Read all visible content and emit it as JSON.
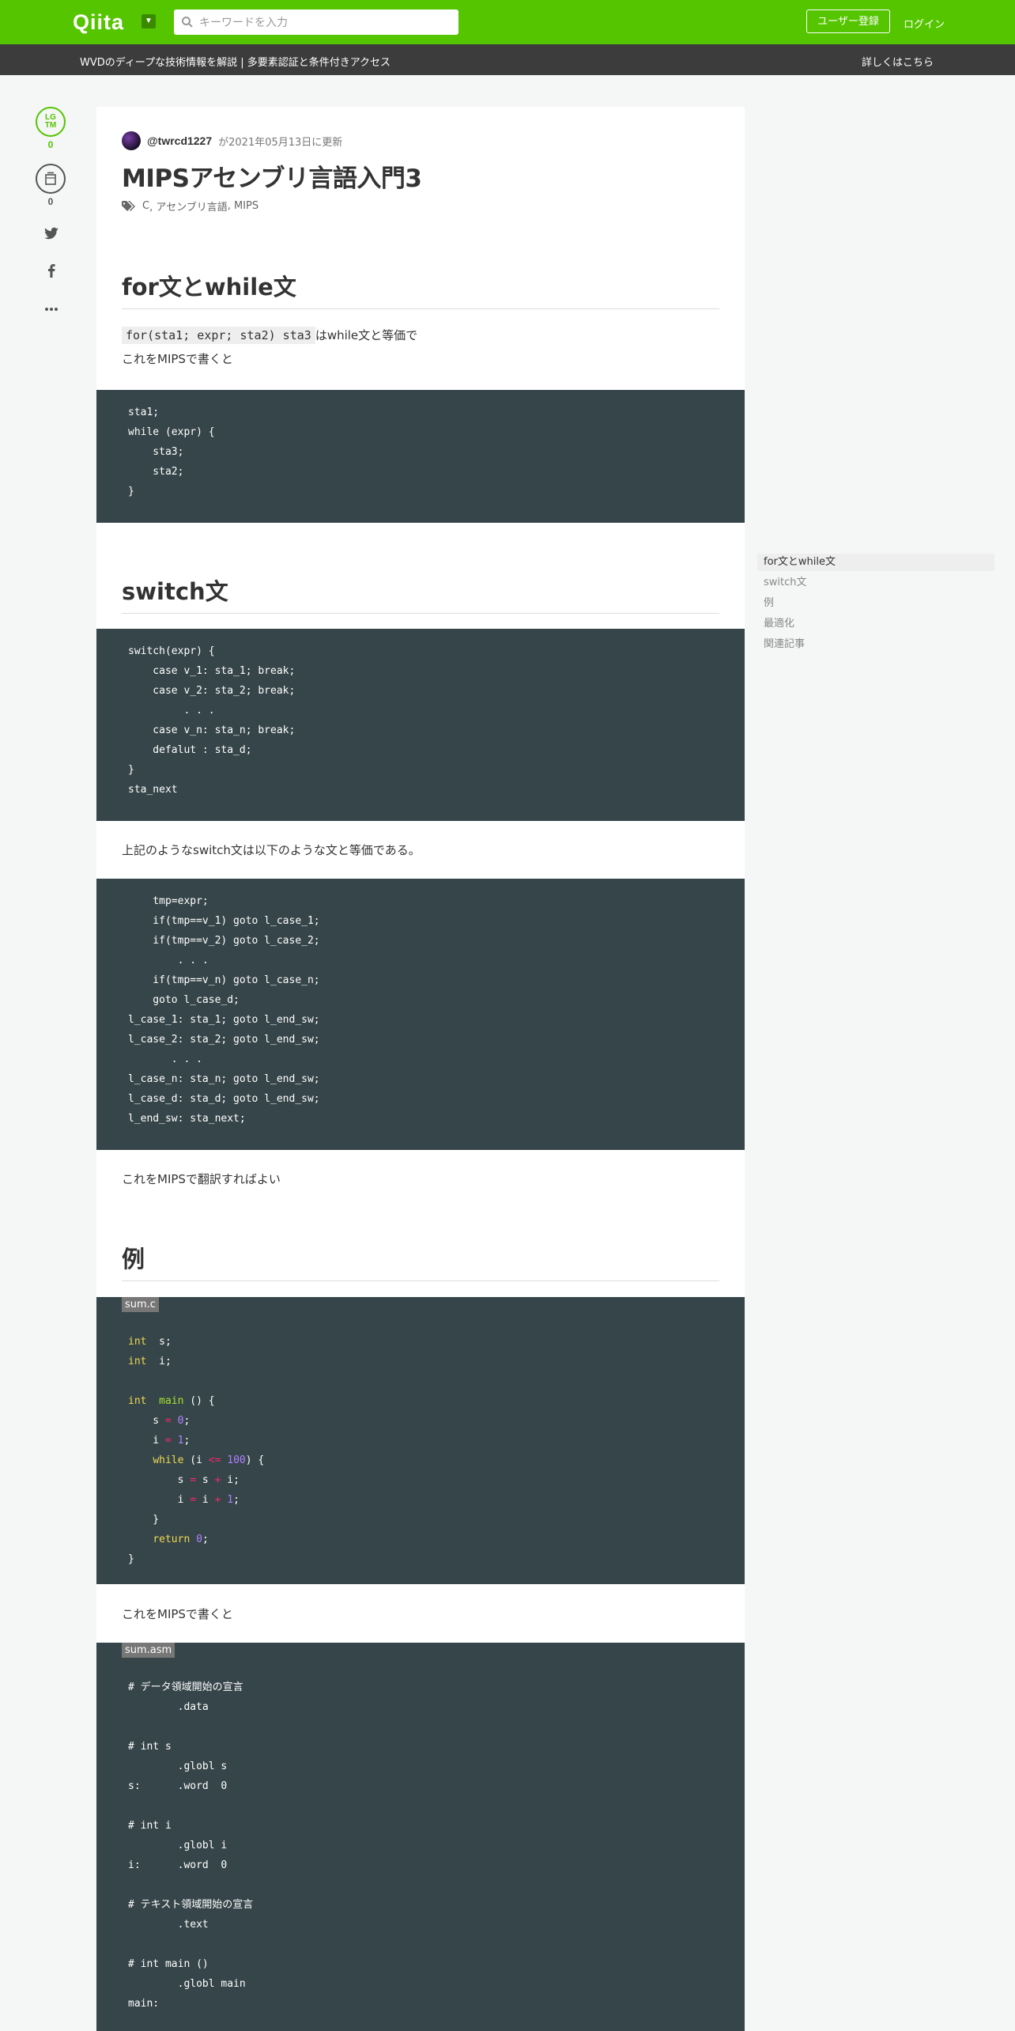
{
  "header": {
    "logo": "Qiita",
    "search_placeholder": "キーワードを入力",
    "signup_label": "ユーザー登録",
    "login_label": "ログイン"
  },
  "announcement": {
    "text": "WVDのディープな技術情報を解説 | 多要素認証と条件付きアクセス",
    "link": "詳しくはこちら"
  },
  "actions": {
    "lgtm_line1": "LG",
    "lgtm_line2": "TM",
    "lgtm_count": "0",
    "stock_count": "0"
  },
  "article": {
    "author": "@twrcd1227",
    "updated": "が2021年05月13日に更新",
    "title": "MIPSアセンブリ言語入門3",
    "tags": [
      "C",
      "アセンブリ言語",
      "MIPS"
    ],
    "sections": {
      "for_heading": "for文とwhile文",
      "for_inline_code": "for(sta1; expr; sta2) sta3",
      "for_text1": "はwhile文と等価で",
      "for_text2": "これをMIPSで書くと",
      "for_code": "sta1;\nwhile (expr) {\n    sta3;\n    sta2;\n}",
      "switch_heading": "switch文",
      "switch_code": "switch(expr) {\n    case v_1: sta_1; break;\n    case v_2: sta_2; break;\n         . . .\n    case v_n: sta_n; break;\n    defalut : sta_d;\n}\nsta_next",
      "switch_text": "上記のようなswitch文は以下のような文と等価である。",
      "goto_code": "    tmp=expr;\n    if(tmp==v_1) goto l_case_1;\n    if(tmp==v_2) goto l_case_2;\n        . . .\n    if(tmp==v_n) goto l_case_n;\n    goto l_case_d;\nl_case_1: sta_1; goto l_end_sw;\nl_case_2: sta_2; goto l_end_sw;\n       . . .\nl_case_n: sta_n; goto l_end_sw;\nl_case_d: sta_d; goto l_end_sw;\nl_end_sw: sta_next;",
      "translate_text": "これをMIPSで翻訳すればよい",
      "example_heading": "例",
      "sum_c_filename": "sum.c",
      "sum_c_lines": [
        [
          [
            "kw",
            "int"
          ],
          [
            "",
            "  s;"
          ]
        ],
        [
          [
            "kw",
            "int"
          ],
          [
            "",
            "  i;"
          ]
        ],
        [
          [
            "",
            ""
          ]
        ],
        [
          [
            "kw",
            "int"
          ],
          [
            "",
            "  "
          ],
          [
            "fn",
            "main"
          ],
          [
            "",
            " () {"
          ]
        ],
        [
          [
            "",
            "    s "
          ],
          [
            "op",
            "="
          ],
          [
            "",
            " "
          ],
          [
            "num",
            "0"
          ],
          [
            "",
            ";"
          ]
        ],
        [
          [
            "",
            "    i "
          ],
          [
            "op",
            "="
          ],
          [
            "",
            " "
          ],
          [
            "num",
            "1"
          ],
          [
            "",
            ";"
          ]
        ],
        [
          [
            "",
            "    "
          ],
          [
            "kw",
            "while"
          ],
          [
            "",
            " (i "
          ],
          [
            "op",
            "<="
          ],
          [
            "",
            " "
          ],
          [
            "num",
            "100"
          ],
          [
            "",
            ") {"
          ]
        ],
        [
          [
            "",
            "        s "
          ],
          [
            "op",
            "="
          ],
          [
            "",
            " s "
          ],
          [
            "op",
            "+"
          ],
          [
            "",
            " i;"
          ]
        ],
        [
          [
            "",
            "        i "
          ],
          [
            "op",
            "="
          ],
          [
            "",
            " i "
          ],
          [
            "op",
            "+"
          ],
          [
            "",
            " "
          ],
          [
            "num",
            "1"
          ],
          [
            "",
            ";"
          ]
        ],
        [
          [
            "",
            "    }"
          ]
        ],
        [
          [
            "",
            "    "
          ],
          [
            "kw",
            "return"
          ],
          [
            "",
            " "
          ],
          [
            "num",
            "0"
          ],
          [
            "",
            ";"
          ]
        ],
        [
          [
            "",
            "}"
          ]
        ]
      ],
      "mips_text": "これをMIPSで書くと",
      "sum_asm_filename": "sum.asm",
      "sum_asm_code": "# データ領域開始の宣言\n        .data\n\n# int s\n        .globl s\ns:      .word  0\n\n# int i\n        .globl i\ni:      .word  0\n\n# テキスト領域開始の宣言\n        .text\n\n# int main ()\n        .globl main\nmain:"
    }
  },
  "toc": {
    "items": [
      "for文とwhile文",
      "switch文",
      "例",
      "最適化",
      "関連記事"
    ]
  }
}
